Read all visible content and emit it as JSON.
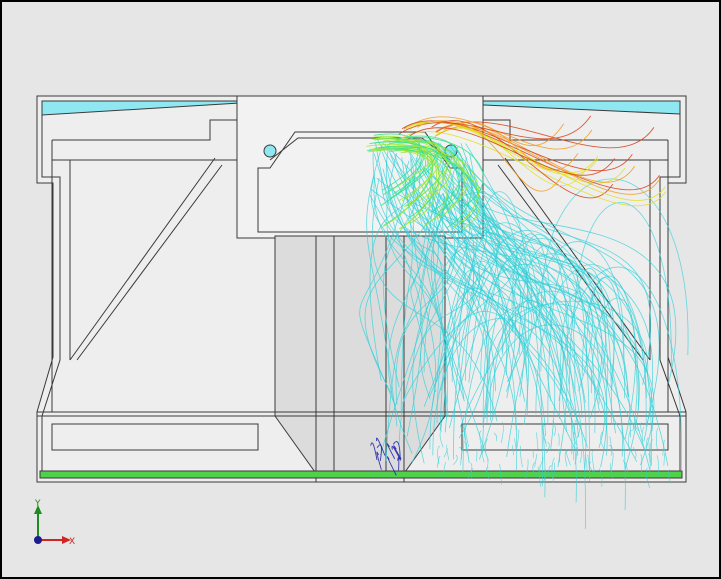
{
  "viewport": {
    "background_color": "#e6e6e6",
    "frame_color": "#000000"
  },
  "model": {
    "outline_color": "#3a3a3a",
    "body_fill": "#eeeeee",
    "inner_panel_fill": "#f2f2f2",
    "top_channel_color": "#8fe7f2",
    "floor_color": "#4fd14a",
    "port_color": "#3f3fb3",
    "nozzle_fill": "#dcdcdc"
  },
  "flow_trajectories": {
    "colormap": [
      "#1a1aa6",
      "#2fd0d8",
      "#33e38c",
      "#9ee62b",
      "#e0e01f",
      "#f29a1f",
      "#d6401a"
    ]
  },
  "coordinate_triad": {
    "x_label": "X",
    "y_label": "Y",
    "x_color": "#d22424",
    "y_color": "#1f8a1f",
    "origin_color": "#1c1c8c"
  }
}
